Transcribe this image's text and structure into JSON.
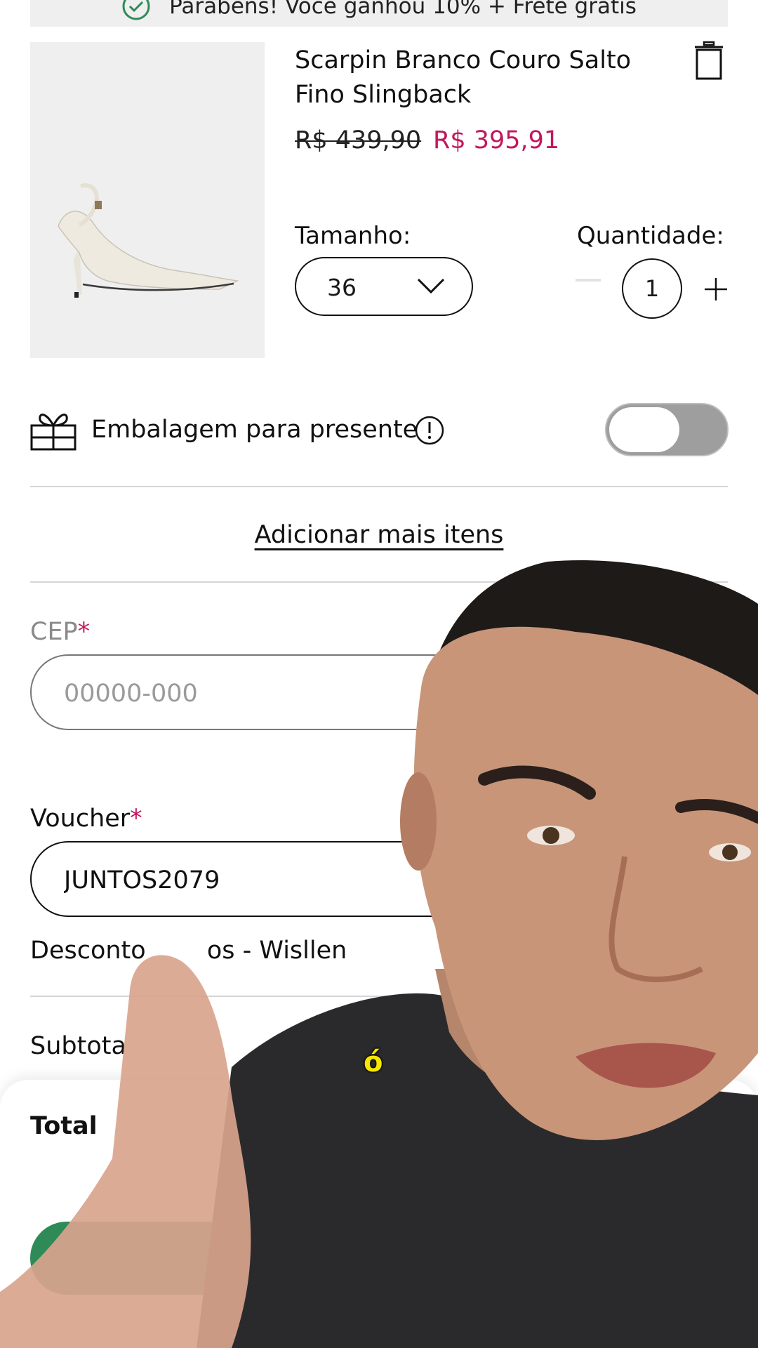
{
  "banner": {
    "text": "Parabéns! Você ganhou 10% + Frete grátis"
  },
  "product": {
    "title": "Scarpin Branco Couro Salto Fino Slingback",
    "old_price": "R$ 439,90",
    "new_price": "R$ 395,91",
    "size_label": "Tamanho:",
    "size_value": "36",
    "quantity_label": "Quantidade:",
    "quantity": "1"
  },
  "gift": {
    "label": "Embalagem para presente",
    "enabled": false
  },
  "add_more": "Adicionar mais itens",
  "cep": {
    "label": "CEP",
    "required_mark": "*",
    "placeholder": "00000-000"
  },
  "voucher": {
    "label": "Voucher",
    "required_mark": "*",
    "value": "JUNTOS2079",
    "description": "Desconto ",
    "description_tail": "os - Wisllen"
  },
  "summary": {
    "subtotal_label": "Subtota",
    "total_label": "Total"
  },
  "overlay": {
    "caption": "ó"
  },
  "colors": {
    "accent_price": "#c2185b",
    "checkout": "#2e8b57",
    "required": "#c2185b"
  }
}
